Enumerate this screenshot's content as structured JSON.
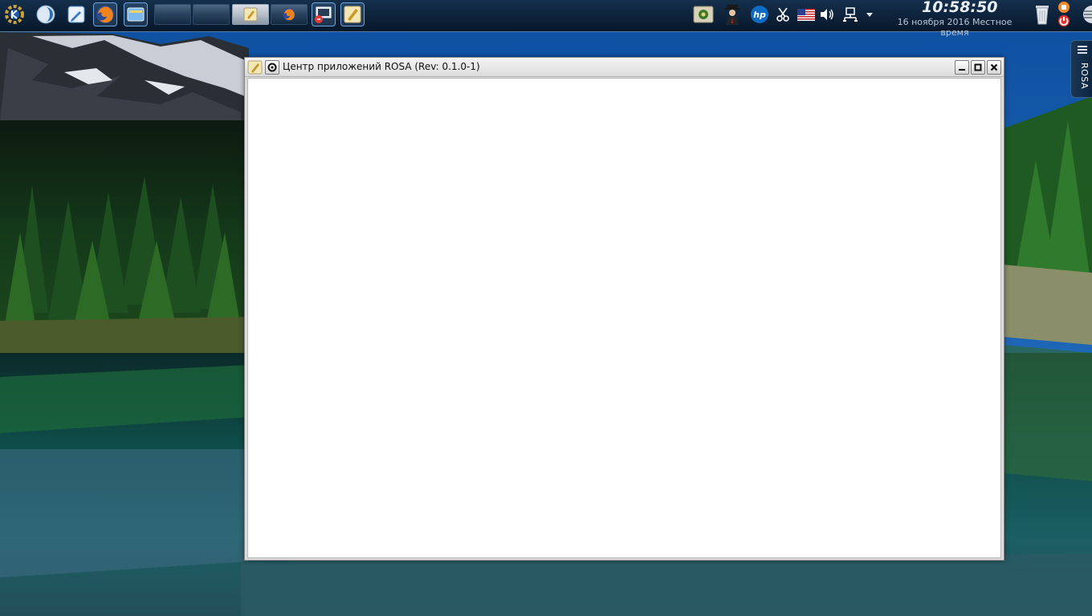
{
  "taskbar": {
    "launchers": [
      {
        "icon": "kde-start-menu-icon"
      },
      {
        "icon": "rosa-launcher-icon"
      },
      {
        "icon": "text-editor-icon"
      },
      {
        "icon": "firefox-icon"
      },
      {
        "icon": "file-manager-icon"
      }
    ],
    "tasks": [
      {
        "icon": ""
      },
      {
        "icon": ""
      },
      {
        "icon": "app-center-icon",
        "active": true
      },
      {
        "icon": "firefox-icon"
      }
    ],
    "quick_launch": [
      {
        "icon": "remote-desktop-icon"
      },
      {
        "icon": "app-center-icon"
      }
    ]
  },
  "tray": {
    "icons": [
      "update-manager-icon",
      "agent-icon",
      "hp-printer-icon",
      "scissors-icon",
      "us-flag-keyboard-icon",
      "speaker-icon",
      "network-icon",
      "tray-expand-arrow-icon"
    ],
    "clock_time": "10:58:50",
    "clock_date": "16 ноября 2016 Местное время",
    "right_icons": [
      "trash-icon",
      "power-icon",
      "panel-toolbox-icon"
    ]
  },
  "side_panel": {
    "label": "ROSA"
  },
  "window": {
    "title": "Центр приложений ROSA (Rev: 0.1.0-1)",
    "buttons": [
      "minimize",
      "maximize",
      "close"
    ]
  },
  "colors": {
    "taskbar_top": "#142f4c",
    "taskbar_bottom": "#08182b",
    "window_client": "#ffffff",
    "window_frame": "#dcdcdc"
  }
}
